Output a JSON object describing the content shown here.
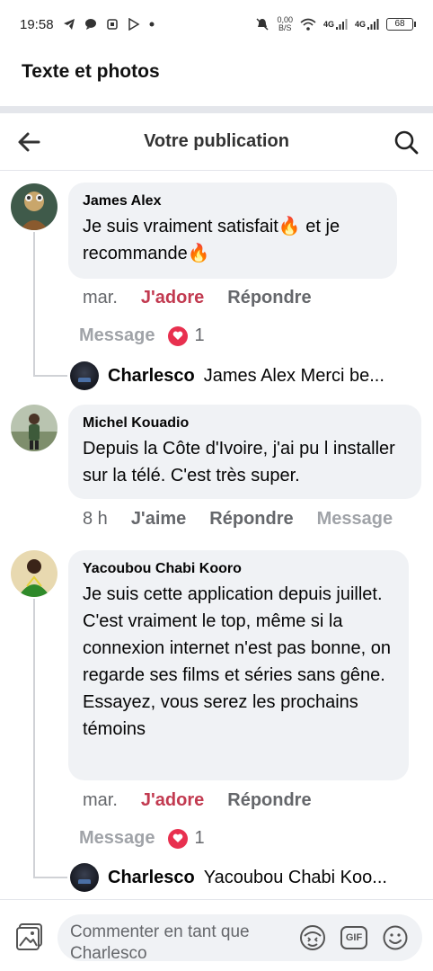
{
  "status_bar": {
    "time": "19:58",
    "net_speed_top": "0,00",
    "net_speed_bottom": "B/S",
    "signal1_label": "4G",
    "signal2_label": "4G",
    "battery": "68"
  },
  "top_title": "Texte et photos",
  "header": {
    "title": "Votre publication"
  },
  "comments": [
    {
      "author": "James Alex",
      "text": "Je suis vraiment satisfait🔥 et je recommande🔥",
      "time": "mar.",
      "like_label": "J'adore",
      "reply_label": "Répondre",
      "message_label": "Message",
      "reaction_count": "1",
      "reply": {
        "author": "Charlesco",
        "text": "James Alex Merci be..."
      }
    },
    {
      "author": "Michel Kouadio",
      "text": "Depuis la Côte d'Ivoire, j'ai pu l installer sur la télé. C'est très super.",
      "time": "8 h",
      "like_label": "J'aime",
      "reply_label": "Répondre",
      "message_label": "Message"
    },
    {
      "author": "Yacoubou Chabi Kooro",
      "text": "Je suis cette application depuis juillet. C'est vraiment le top, même si la connexion internet n'est pas bonne, on regarde ses films et séries sans gêne.\nEssayez, vous serez les prochains témoins",
      "time": "mar.",
      "like_label": "J'adore",
      "reply_label": "Répondre",
      "message_label": "Message",
      "reaction_count": "1",
      "reply": {
        "author": "Charlesco",
        "text": "Yacoubou Chabi Koo..."
      }
    }
  ],
  "composer": {
    "placeholder": "Commenter en tant que Charlesco",
    "gif_label": "GIF"
  },
  "colors": {
    "love_red": "#c23a50",
    "bubble_bg": "#f0f2f5",
    "muted_text": "#65676b"
  }
}
